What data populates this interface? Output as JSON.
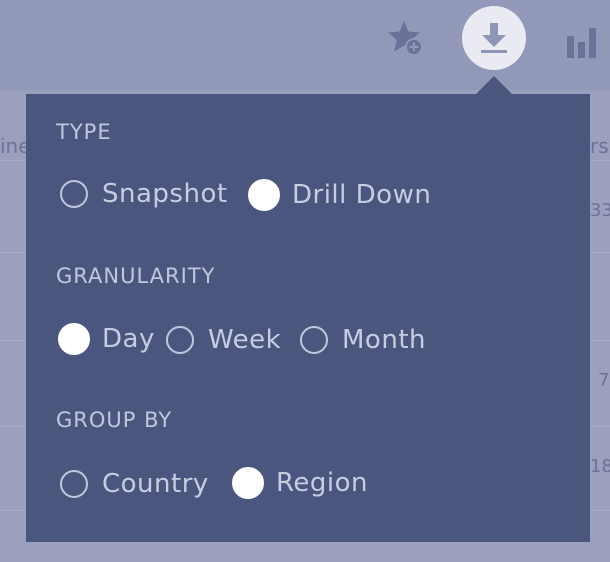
{
  "toolbar": {
    "icons": [
      "star-plus-icon",
      "download-icon",
      "bar-chart-icon"
    ]
  },
  "background": {
    "col_header_left": "ine",
    "col_header_right": "rs",
    "cells": [
      "33",
      "7",
      "18"
    ]
  },
  "popover": {
    "type": {
      "label": "TYPE",
      "options": [
        "Snapshot",
        "Drill Down"
      ],
      "selected": "Drill Down"
    },
    "granularity": {
      "label": "GRANULARITY",
      "options": [
        "Day",
        "Week",
        "Month"
      ],
      "selected": "Day"
    },
    "group_by": {
      "label": "GROUP BY",
      "options": [
        "Country",
        "Region"
      ],
      "selected": "Region"
    }
  },
  "colors": {
    "popover_bg": "#4b567e",
    "overlay_bg": "#8f95b5",
    "radio_selected": "#ffffff",
    "text": "#c8cce2"
  }
}
